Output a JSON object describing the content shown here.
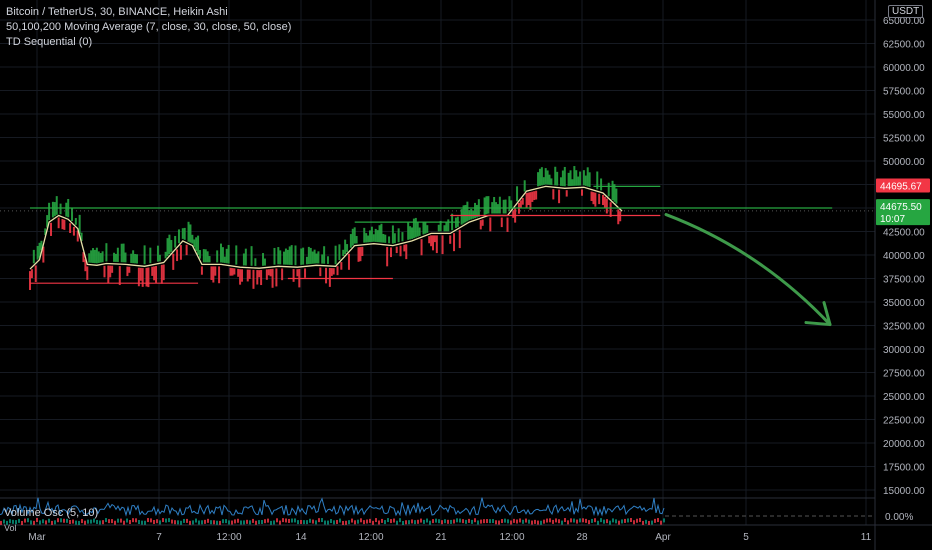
{
  "legend": {
    "symbol": "Bitcoin / TetherUS, 30, BINANCE, Heikin Ashi",
    "ma": "50,100,200 Moving Average (7, close, 30, close, 50, close)",
    "td": "TD Sequential (0)"
  },
  "currency_label": "USDT",
  "oscillator": {
    "label": "Volume Osc (5, 10)",
    "sublabel": "Vol",
    "value": "0.00%"
  },
  "price_tags": {
    "last": "44695.67",
    "current": "44675.50",
    "countdown": "10:07"
  },
  "colors": {
    "up": "#089981",
    "down": "#f23645",
    "td_green": "#26a641",
    "ma": "#e8e0a8",
    "arrow": "#3e9a4a",
    "osc": "#2f7fc4"
  },
  "chart_data": {
    "type": "line",
    "title": "Bitcoin / TetherUS, 30, BINANCE, Heikin Ashi",
    "ylim": [
      13500,
      65000
    ],
    "y_ticks": [
      "65000.00",
      "62500.00",
      "60000.00",
      "57500.00",
      "55000.00",
      "52500.00",
      "50000.00",
      "47500.00",
      "45000.00",
      "42500.00",
      "40000.00",
      "37500.00",
      "35000.00",
      "32500.00",
      "30000.00",
      "27500.00",
      "25000.00",
      "22500.00",
      "20000.00",
      "17500.00",
      "15000.00"
    ],
    "x_ticks": [
      "Mar",
      "7",
      "12:00",
      "14",
      "12:00",
      "21",
      "12:00",
      "28",
      "Apr",
      "5",
      "11"
    ],
    "series": [
      {
        "x": [
          "Mar 1",
          "Mar 1.5",
          "Mar 2",
          "Mar 2.5",
          "Mar 3",
          "Mar 3.5",
          "Mar 4",
          "Mar 4.5",
          "Mar 5",
          "Mar 6",
          "Mar 7",
          "Mar 8",
          "Mar 9",
          "Mar 9.5",
          "Mar 10",
          "Mar 11",
          "Mar 12",
          "Mar 13",
          "Mar 14",
          "Mar 15",
          "Mar 16",
          "Mar 17",
          "Mar 18",
          "Mar 19",
          "Mar 20",
          "Mar 21",
          "Mar 22",
          "Mar 23",
          "Mar 24",
          "Mar 25",
          "Mar 26",
          "Mar 27",
          "Mar 28",
          "Mar 29",
          "Mar 30",
          "Mar 31",
          "Apr 1"
        ],
        "values": [
          38500,
          39500,
          43500,
          44200,
          43800,
          42800,
          39000,
          38900,
          39100,
          39000,
          38800,
          39200,
          41500,
          41000,
          39000,
          39000,
          38700,
          38600,
          38800,
          38700,
          38900,
          38800,
          41000,
          41200,
          41000,
          41500,
          42300,
          42300,
          43500,
          44200,
          44200,
          46800,
          47300,
          47100,
          47200,
          46600,
          44675
        ]
      }
    ],
    "annotations": [
      "Downward arrow projection toward ~32500"
    ]
  }
}
